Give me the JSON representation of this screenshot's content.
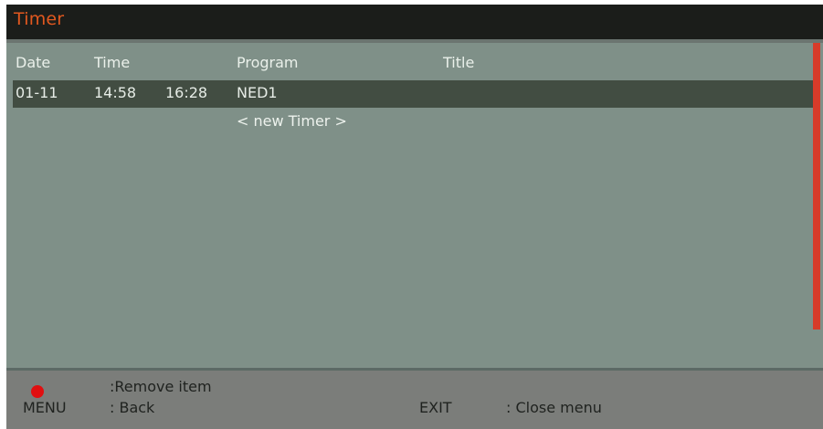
{
  "window": {
    "title": "Timer"
  },
  "columns": {
    "date": "Date",
    "time": "Time",
    "program": "Program",
    "title": "Title"
  },
  "timers": [
    {
      "date": "01-11",
      "start": "14:58",
      "end": "16:28",
      "program": "NED1"
    }
  ],
  "new_timer_label": "< new Timer >",
  "footer": {
    "remove_label": ":Remove item",
    "menu_key": "MENU",
    "menu_desc": ": Back",
    "exit_key": "EXIT",
    "exit_desc": ": Close menu"
  },
  "colors": {
    "title_text": "#e2581f",
    "title_bar": "#1b1d1a",
    "content_bg": "#7f9088",
    "selected_row": "#424d42",
    "scrollbar_thumb": "#d73b2a",
    "footer_bg": "#7b7d7a",
    "red_button": "#e10f10"
  },
  "icons": {
    "red_button": "red-circle-icon"
  }
}
